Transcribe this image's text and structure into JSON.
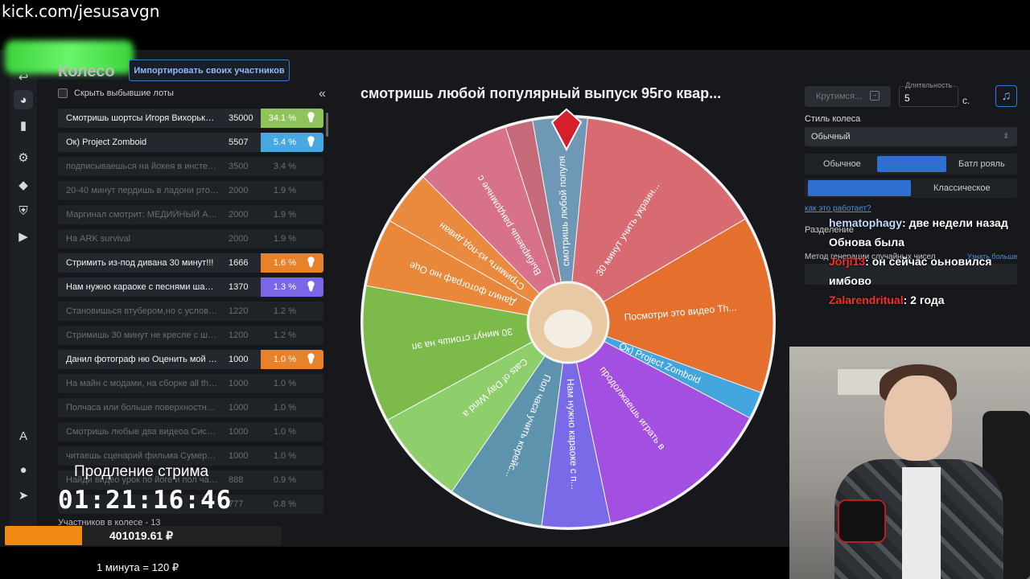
{
  "stream": {
    "url": "kick.com/jesusavgn",
    "extension_label": "Продление стрима",
    "timer": "01:21:16:46",
    "money": "401019.61 ₽",
    "money_fill": 0.28,
    "rate": "1 минута = 120 ₽"
  },
  "panel": {
    "title": "Колесо",
    "import_label": "Импортировать своих участников",
    "hide_label": "Скрыть выбывшие лоты",
    "collapse": "«",
    "participants": "Участников в колесе - 13"
  },
  "lots": [
    {
      "name": "Смотришь шортсы Игоря Вихорьков...",
      "amount": "35000",
      "pct": "34.1 %",
      "status": "active",
      "color": "#8fc45a"
    },
    {
      "name": "Ок) Project Zomboid",
      "amount": "5507",
      "pct": "5.4 %",
      "status": "active",
      "color": "#48a9e0"
    },
    {
      "name": "подписываешься на йокея в инсте, ли...",
      "amount": "3500",
      "pct": "3.4 %",
      "status": "out",
      "color": ""
    },
    {
      "name": "20-40 минут пердишь в ладони ртом...",
      "amount": "2000",
      "pct": "1.9 %",
      "status": "out",
      "color": ""
    },
    {
      "name": "Маргинал смотрит: МЕДИЙНЫЙ АД 3...",
      "amount": "2000",
      "pct": "1.9 %",
      "status": "out",
      "color": ""
    },
    {
      "name": "На ARK survival",
      "amount": "2000",
      "pct": "1.9 %",
      "status": "out",
      "color": ""
    },
    {
      "name": "Стримить из-под дивана 30 минут!!!",
      "amount": "1666",
      "pct": "1.6 %",
      "status": "active",
      "color": "#e8822a"
    },
    {
      "name": "Нам нужно караоке с песнями шамана",
      "amount": "1370",
      "pct": "1.3 %",
      "status": "active",
      "color": "#7b66e6"
    },
    {
      "name": "Становишься втубером,но с условие...",
      "amount": "1220",
      "pct": "1.2 %",
      "status": "out",
      "color": ""
    },
    {
      "name": "Стримишь 30 минут не кресле с широ...",
      "amount": "1200",
      "pct": "1.2 %",
      "status": "out",
      "color": ""
    },
    {
      "name": "Данил фотограф ню Оценить мой про...",
      "amount": "1000",
      "pct": "1.0 %",
      "status": "active",
      "color": "#e8822a"
    },
    {
      "name": "На майн с модами, на сборке all the m...",
      "amount": "1000",
      "pct": "1.0 %",
      "status": "out",
      "color": ""
    },
    {
      "name": "Полчаса или больше поверхностно и...",
      "amount": "1000",
      "pct": "1.0 %",
      "status": "out",
      "color": ""
    },
    {
      "name": "Смотришь любые два видеоа Сисуна...",
      "amount": "1000",
      "pct": "1.0 %",
      "status": "out",
      "color": ""
    },
    {
      "name": "читаешь сценарий фильма Сумерки и...",
      "amount": "1000",
      "pct": "1.0 %",
      "status": "out",
      "color": ""
    },
    {
      "name": "Найди видео урок по йоге и пол часа...",
      "amount": "888",
      "pct": "0.9 %",
      "status": "out",
      "color": ""
    },
    {
      "name": "",
      "amount": "777",
      "pct": "0.8 %",
      "status": "out",
      "color": ""
    }
  ],
  "wheel": {
    "title": "смотришь любой популярный выпуск 95го квар...",
    "segments": [
      {
        "label": "смотришь любой популя",
        "color": "#6f98b6",
        "weight": 4
      },
      {
        "label": "30 минут учить украин...",
        "color": "#d76b71",
        "weight": 14
      },
      {
        "label": "Посмотри это видео Th...",
        "color": "#e56f2c",
        "weight": 13
      },
      {
        "label": "Ок) Project Zomboid",
        "color": "#43a5de",
        "weight": 2
      },
      {
        "label": "продолжаешь играть в",
        "color": "#a24fe2",
        "weight": 13
      },
      {
        "label": "Нам нужно караоке с п...",
        "color": "#7a6ae8",
        "weight": 5
      },
      {
        "label": "Пол часа учить корейс...",
        "color": "#5e93ad",
        "weight": 7
      },
      {
        "label": "Cats of Day Wind a",
        "color": "#8fcf6b",
        "weight": 7
      },
      {
        "label": "30 минут стоишь на эп",
        "color": "#7cba4a",
        "weight": 10
      },
      {
        "label": "Данил фотограф ню Оце",
        "color": "#e9883a",
        "weight": 5
      },
      {
        "label": "Стримить из-под диван",
        "color": "#ea8a3f",
        "weight": 4
      },
      {
        "label": "Выбираешь рандомные с",
        "color": "#d8728a",
        "weight": 7
      },
      {
        "label": "",
        "color": "#c66a7a",
        "weight": 2
      }
    ]
  },
  "controls": {
    "spin_label": "Крутимся...",
    "spin_dash": "−",
    "duration_label": "Длительность",
    "duration_value": "5",
    "seconds": "с.",
    "music_icon": "♫",
    "style_label": "Стиль колеса",
    "style_value": "Обычный",
    "mode_normal": "Обычное",
    "mode_battle": "Батл рояль",
    "mode_classic": "Классическое",
    "how_link": "как это работает?",
    "split_label": "Разделение",
    "method_label": "Метод генерации случайных чисел",
    "learn_more": "Узнать больше"
  },
  "chat": [
    {
      "user": "hematophagy",
      "text": ": две недели назад",
      "red": false
    },
    {
      "user": "",
      "text": "Обнова была",
      "red": false
    },
    {
      "user": "Jorji13",
      "text": ": он сейчас оьновился",
      "red": true
    },
    {
      "user": "",
      "text": "имбово",
      "red": false
    },
    {
      "user": "Zalarendritual",
      "text": ": 2 года",
      "red": true
    }
  ]
}
